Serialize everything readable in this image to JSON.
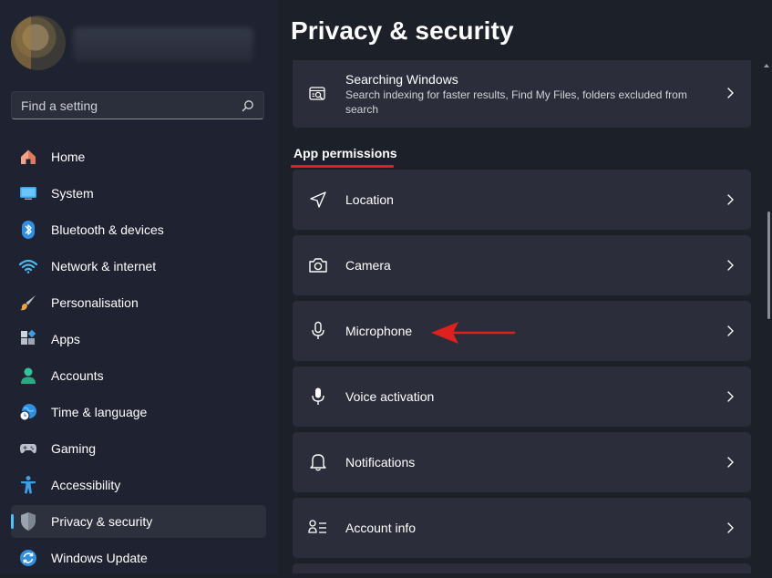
{
  "sidebar": {
    "search": {
      "placeholder": "Find a setting"
    },
    "items": [
      {
        "label": "Home",
        "icon": "home-icon"
      },
      {
        "label": "System",
        "icon": "monitor-icon"
      },
      {
        "label": "Bluetooth & devices",
        "icon": "bluetooth-icon"
      },
      {
        "label": "Network & internet",
        "icon": "wifi-icon"
      },
      {
        "label": "Personalisation",
        "icon": "brush-icon"
      },
      {
        "label": "Apps",
        "icon": "apps-icon"
      },
      {
        "label": "Accounts",
        "icon": "person-icon"
      },
      {
        "label": "Time & language",
        "icon": "globe-clock-icon"
      },
      {
        "label": "Gaming",
        "icon": "gamepad-icon"
      },
      {
        "label": "Accessibility",
        "icon": "accessibility-icon"
      },
      {
        "label": "Privacy & security",
        "icon": "shield-icon",
        "active": true
      },
      {
        "label": "Windows Update",
        "icon": "update-icon"
      }
    ]
  },
  "main": {
    "title": "Privacy & security",
    "searching_windows": {
      "label": "Searching Windows",
      "description": "Search indexing for faster results, Find My Files, folders excluded from search"
    },
    "section_title": "App permissions",
    "permissions": [
      {
        "label": "Location",
        "icon": "location-icon"
      },
      {
        "label": "Camera",
        "icon": "camera-icon"
      },
      {
        "label": "Microphone",
        "icon": "microphone-icon"
      },
      {
        "label": "Voice activation",
        "icon": "voice-mic-icon"
      },
      {
        "label": "Notifications",
        "icon": "bell-icon"
      },
      {
        "label": "Account info",
        "icon": "account-info-icon"
      }
    ]
  },
  "colors": {
    "accent": "#4cc2ff",
    "annotation": "#e0201c",
    "background": "#1c2029",
    "card": "#2b2e3a"
  }
}
